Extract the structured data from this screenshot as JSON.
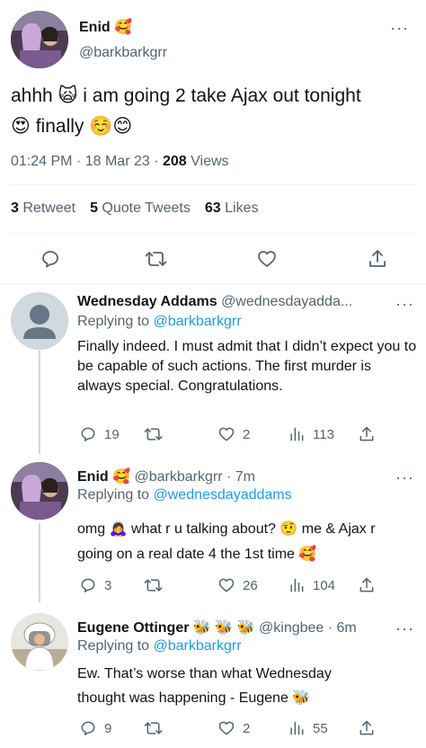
{
  "main_tweet": {
    "author": {
      "name": "Enid",
      "emoji": "🥰",
      "handle": "@barkbarkgrr"
    },
    "text_line1": "ahhh 🙀 i am going 2 take Ajax out tonight",
    "text_line2": "😍 finally ☺️😊",
    "time": "01:24 PM",
    "dot1": "·",
    "date": "18 Mar 23",
    "dot2": "·",
    "views_count": "208",
    "views_label": "Views",
    "retweets_count": "3",
    "retweets_label": "Retweet",
    "quotes_count": "5",
    "quotes_label": "Quote Tweets",
    "likes_count": "63",
    "likes_label": "Likes",
    "more": "···"
  },
  "replies": [
    {
      "name": "Wednesday Addams",
      "handle": "@wednesdayadda...",
      "replying_prefix": "Replying to",
      "replying_to": "@barkbarkgrr",
      "text": "Finally indeed. I must admit that I didn’t expect you to be capable of such actions. The first murder is always special. Congratulations.",
      "reply_count": "19",
      "retweet_count": "",
      "like_count": "2",
      "view_count": "113",
      "more": "···"
    },
    {
      "name": "Enid",
      "emoji": "🥰",
      "handle": "@barkbarkgrr · 7m",
      "replying_prefix": "Replying to",
      "replying_to": "@wednesdayaddams",
      "text": "omg 🙇‍♀️ what r u talking about? 🤨 me & Ajax r going on a real date 4 the 1st time 🥰",
      "reply_count": "3",
      "retweet_count": "",
      "like_count": "26",
      "view_count": "104",
      "more": "···"
    },
    {
      "name": "Eugene Ottinger",
      "emoji": "🐝 🐝 🐝",
      "handle": "@kingbee · 6m",
      "replying_prefix": "Replying to",
      "replying_to": "@barkbarkgrr",
      "text": "Ew. That’s worse than what Wednesday thought was happening - Eugene 🐝",
      "reply_count": "9",
      "retweet_count": "",
      "like_count": "2",
      "view_count": "55",
      "more": "···"
    }
  ],
  "icons": {
    "reply": "reply-icon",
    "retweet": "retweet-icon",
    "like": "heart-icon",
    "share": "share-icon",
    "views": "views-icon"
  },
  "colors": {
    "accent": "#1d9bf0",
    "text": "#0f1419",
    "muted": "#536471",
    "divider": "#eff3f4",
    "thread_line": "#cfd9de"
  }
}
